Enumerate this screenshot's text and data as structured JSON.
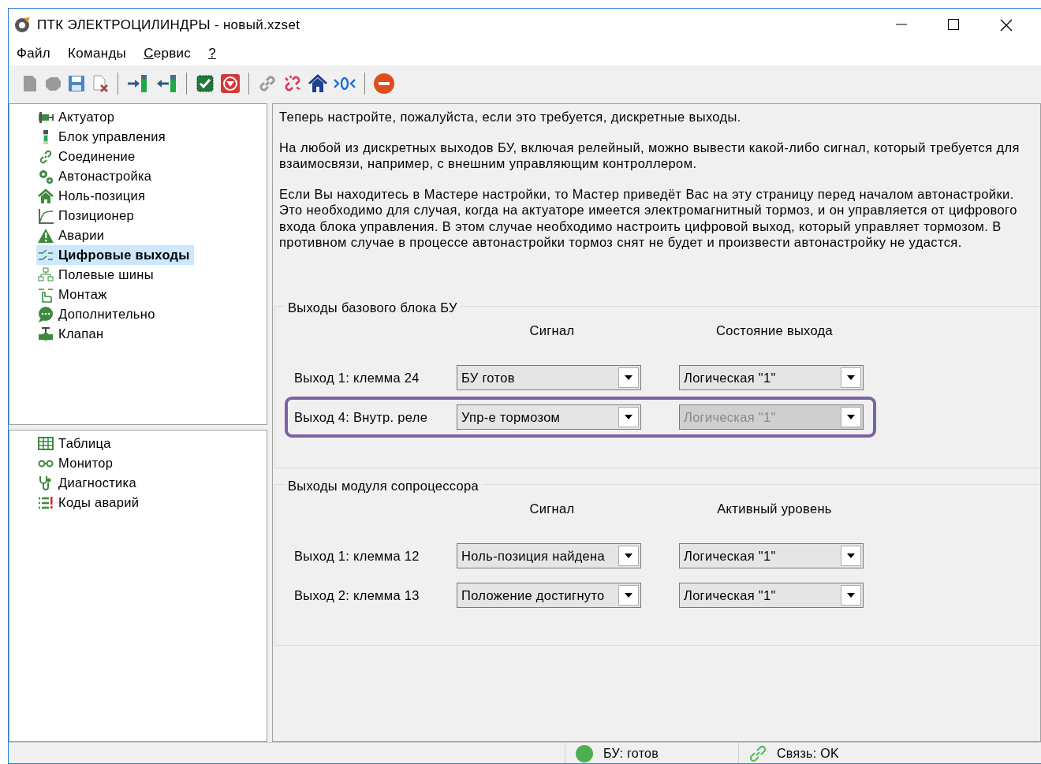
{
  "window": {
    "title": "ПТК ЭЛЕКТРОЦИЛИНДРЫ - новый.xzset"
  },
  "menu": [
    {
      "label": "Файл",
      "underlined": false
    },
    {
      "label": "Команды",
      "underlined": false
    },
    {
      "label": "Сервис",
      "underlined": true
    },
    {
      "label": "?",
      "underlined": true
    }
  ],
  "sidebar": {
    "items": [
      {
        "label": "Актуатор",
        "selected": false
      },
      {
        "label": "Блок управления",
        "selected": false
      },
      {
        "label": "Соединение",
        "selected": false
      },
      {
        "label": "Автонастройка",
        "selected": false
      },
      {
        "label": "Ноль-позиция",
        "selected": false
      },
      {
        "label": "Позиционер",
        "selected": false
      },
      {
        "label": "Аварии",
        "selected": false
      },
      {
        "label": "Цифровые выходы",
        "selected": true
      },
      {
        "label": "Полевые шины",
        "selected": false
      },
      {
        "label": "Монтаж",
        "selected": false
      },
      {
        "label": "Дополнительно",
        "selected": false
      },
      {
        "label": "Клапан",
        "selected": false
      }
    ],
    "tools": [
      {
        "label": "Таблица",
        "selected": false
      },
      {
        "label": "Монитор",
        "selected": false
      },
      {
        "label": "Диагностика",
        "selected": false
      },
      {
        "label": "Коды аварий",
        "selected": false
      }
    ]
  },
  "content": {
    "paragraphs": [
      "Теперь настройте, пожалуйста, если это требуется, дискретные выходы.",
      "На любой из дискретных выходов БУ, включая релейный, можно вывести какой-либо сигнал, который требуется для взаимосвязи, например, с внешним управляющим контроллером.",
      "Если Вы находитесь в Мастере настройки, то Мастер приведёт Вас на эту страницу перед началом автонастройки. Это необходимо для случая, когда на актуаторе имеется электромагнитный тормоз, и он управляется от цифрового входа блока управления. В этом случае необходимо настроить цифровой выход, который управляет тормозом. В противном случае в процессе автонастройки тормоз снят не будет и произвести автонастройку не удастся."
    ],
    "groups": [
      {
        "title": "Выходы базового блока БУ",
        "column_headers": [
          "Сигнал",
          "Состояние выхода"
        ],
        "rows": [
          {
            "label": "Выход 1: клемма 24",
            "signal": {
              "value": "БУ готов",
              "disabled": false
            },
            "state": {
              "value": "Логическая \"1\"",
              "disabled": false
            },
            "highlighted": false
          },
          {
            "label": "Выход 4: Внутр. реле",
            "signal": {
              "value": "Упр-е тормозом",
              "disabled": false
            },
            "state": {
              "value": "Логическая \"1\"",
              "disabled": true
            },
            "highlighted": true
          }
        ]
      },
      {
        "title": "Выходы модуля сопроцессора",
        "column_headers": [
          "Сигнал",
          "Активный уровень"
        ],
        "rows": [
          {
            "label": "Выход 1: клемма 12",
            "signal": {
              "value": "Ноль-позиция найдена",
              "disabled": false
            },
            "state": {
              "value": "Логическая \"1\"",
              "disabled": false
            },
            "highlighted": false
          },
          {
            "label": "Выход 2: клемма 13",
            "signal": {
              "value": "Положение достигнуто",
              "disabled": false
            },
            "state": {
              "value": "Логическая \"1\"",
              "disabled": false
            },
            "highlighted": false
          }
        ]
      }
    ]
  },
  "status_bar": [
    {
      "text": "БУ: готов",
      "color": "#4caf50"
    },
    {
      "text": "Связь: OK",
      "color": "#5cb85c"
    }
  ]
}
